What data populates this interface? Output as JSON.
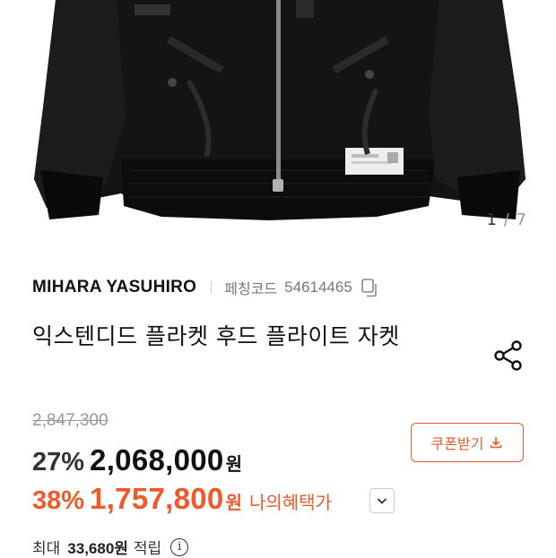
{
  "gallery": {
    "current": "1",
    "separator": "/",
    "total": "7",
    "image_subject": "black-bomber-jacket"
  },
  "product": {
    "brand": "MIHARA YASUHIRO",
    "code_label": "페칭코드",
    "code_value": "54614465",
    "title": "익스텐디드 플라켓 후드 플라이트 자켓"
  },
  "pricing": {
    "original_price": "2,847,300",
    "discount_pct": "27%",
    "sale_price": "2,068,000",
    "currency": "원",
    "my_pct": "38%",
    "my_price": "1,757,800",
    "my_benefit_label": "나의혜택가",
    "coupon_label": "쿠폰받기"
  },
  "points": {
    "prefix": "최대",
    "value": "33,680원",
    "suffix": "적립",
    "info_glyph": "i"
  },
  "colors": {
    "accent": "#ee5a2a",
    "text": "#111111",
    "muted": "#999999"
  }
}
